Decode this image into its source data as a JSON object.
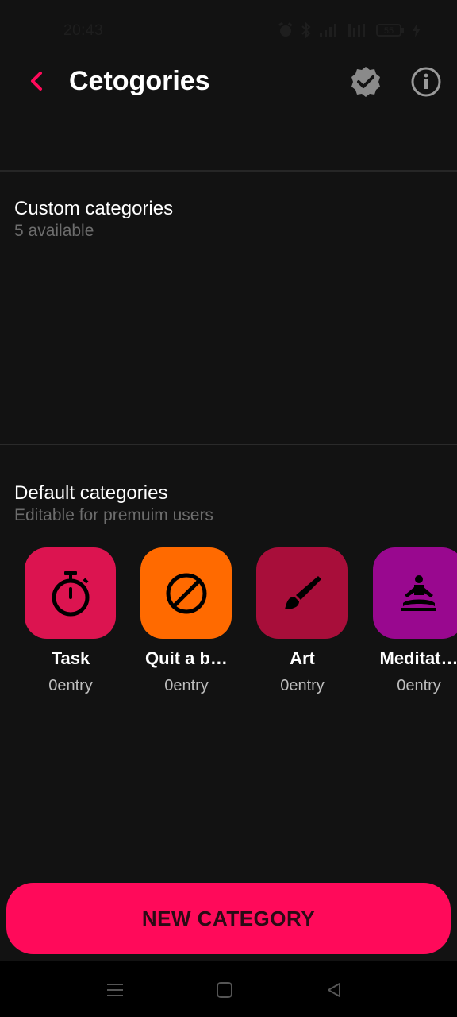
{
  "status_bar": {
    "time": "20:43",
    "battery": "55",
    "icons": [
      "alarm-icon",
      "bluetooth-icon",
      "signal-icon",
      "hd-signal-icon",
      "battery-icon",
      "charging-icon"
    ]
  },
  "header": {
    "title": "Cetogories",
    "back_icon": "chevron-left-icon",
    "verified_icon": "verified-badge-icon",
    "info_icon": "info-icon",
    "accent_color": "#ff0a5a"
  },
  "custom_section": {
    "title": "Custom categories",
    "subtitle": "5 available"
  },
  "default_section": {
    "title": "Default categories",
    "subtitle": "Editable for premuim users",
    "items": [
      {
        "name": "Task",
        "count": "0entry",
        "icon": "stopwatch-icon",
        "color": "#dc1450"
      },
      {
        "name": "Quit a b…",
        "count": "0entry",
        "icon": "prohibited-icon",
        "color": "#ff6a00"
      },
      {
        "name": "Art",
        "count": "0entry",
        "icon": "paintbrush-icon",
        "color": "#a80e3a"
      },
      {
        "name": "Meditat…",
        "count": "0entry",
        "icon": "meditation-icon",
        "color": "#99088f"
      }
    ]
  },
  "action": {
    "new_category_label": "NEW CATEGORY",
    "color": "#ff0a5a"
  },
  "nav_bar": {
    "icons": [
      "menu-icon",
      "home-icon",
      "back-icon"
    ]
  }
}
